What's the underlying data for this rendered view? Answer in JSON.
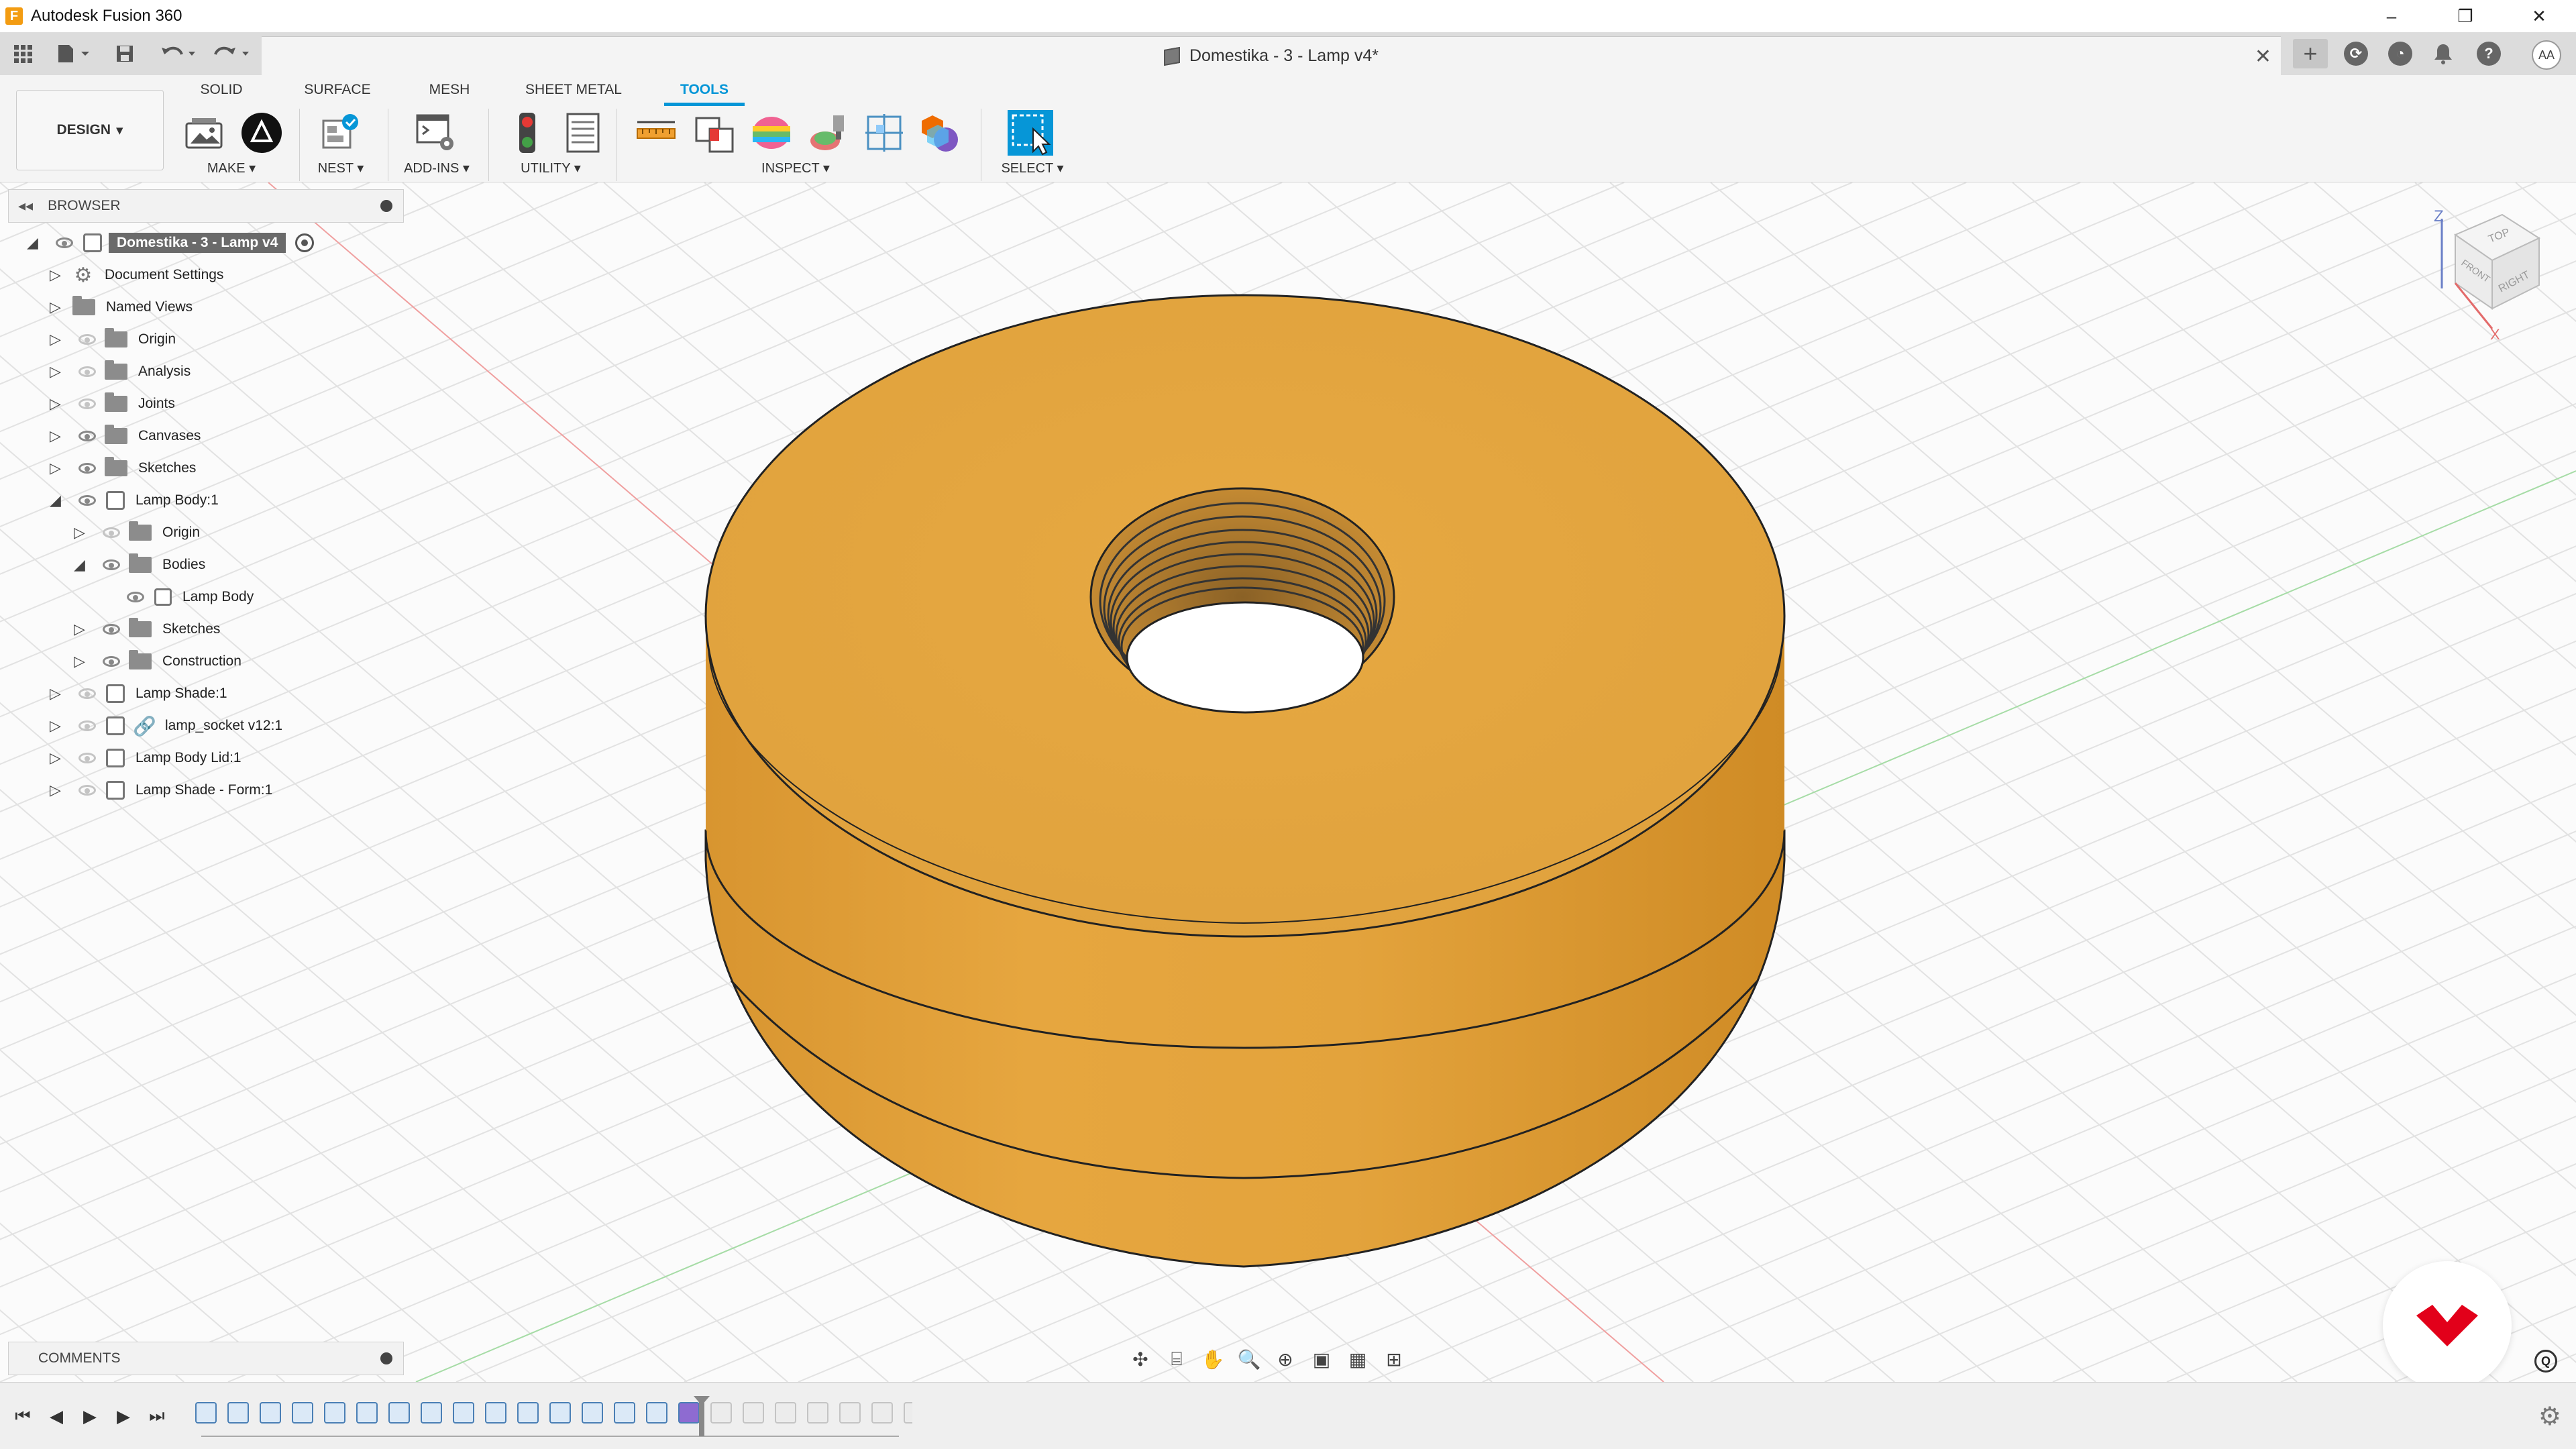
{
  "window": {
    "app_icon": "F",
    "title": "Autodesk Fusion 360",
    "controls": {
      "minimize": "–",
      "restore": "❐",
      "close": "✕"
    }
  },
  "tab": {
    "document_title": "Domestika - 3 - Lamp v4*",
    "close": "✕"
  },
  "right_icons": {
    "plus": "+",
    "avatar": "AA"
  },
  "workspace": {
    "label": "DESIGN",
    "chevron": "▾"
  },
  "toolbar": {
    "tabs": [
      {
        "label": "SOLID",
        "active": false
      },
      {
        "label": "SURFACE",
        "active": false
      },
      {
        "label": "MESH",
        "active": false
      },
      {
        "label": "SHEET METAL",
        "active": false
      },
      {
        "label": "TOOLS",
        "active": true
      }
    ],
    "groups": [
      {
        "label": "MAKE ▾"
      },
      {
        "label": "NEST ▾"
      },
      {
        "label": "ADD-INS ▾"
      },
      {
        "label": "UTILITY ▾"
      },
      {
        "label": "INSPECT ▾"
      },
      {
        "label": "SELECT ▾"
      }
    ]
  },
  "browser": {
    "collapse": "◂◂",
    "header": "BROWSER",
    "items": [
      {
        "label": "Domestika - 3 - Lamp v4",
        "expand": "◢",
        "kind": "root",
        "visible": true
      },
      {
        "label": "Document Settings",
        "expand": "▷",
        "kind": "gear",
        "visible": null
      },
      {
        "label": "Named Views",
        "expand": "▷",
        "kind": "folder",
        "visible": null
      },
      {
        "label": "Origin",
        "expand": "▷",
        "kind": "folder",
        "visible": false
      },
      {
        "label": "Analysis",
        "expand": "▷",
        "kind": "folder",
        "visible": false
      },
      {
        "label": "Joints",
        "expand": "▷",
        "kind": "folder",
        "visible": false
      },
      {
        "label": "Canvases",
        "expand": "▷",
        "kind": "folder",
        "visible": true
      },
      {
        "label": "Sketches",
        "expand": "▷",
        "kind": "folder",
        "visible": true
      },
      {
        "label": "Lamp Body:1",
        "expand": "◢",
        "kind": "component",
        "visible": true
      },
      {
        "label": "Origin",
        "expand": "▷",
        "kind": "folder",
        "visible": false
      },
      {
        "label": "Bodies",
        "expand": "◢",
        "kind": "folder",
        "visible": true
      },
      {
        "label": "Lamp Body",
        "expand": "",
        "kind": "body",
        "visible": true
      },
      {
        "label": "Sketches",
        "expand": "▷",
        "kind": "folder",
        "visible": true
      },
      {
        "label": "Construction",
        "expand": "▷",
        "kind": "folder",
        "visible": true
      },
      {
        "label": "Lamp Shade:1",
        "expand": "▷",
        "kind": "component",
        "visible": false
      },
      {
        "label": "lamp_socket v12:1",
        "expand": "▷",
        "kind": "link",
        "visible": false
      },
      {
        "label": "Lamp Body Lid:1",
        "expand": "▷",
        "kind": "component",
        "visible": false
      },
      {
        "label": "Lamp Shade - Form:1",
        "expand": "▷",
        "kind": "component",
        "visible": false
      }
    ]
  },
  "comments": {
    "header": "COMMENTS"
  },
  "viewcube": {
    "axis_z": "Z",
    "axis_x": "X",
    "top": "TOP",
    "right": "RIGHT",
    "front": "FRONT"
  },
  "timeline": {
    "controls": [
      "⏮",
      "◀",
      "▶",
      "▶",
      "⏭"
    ]
  },
  "colors": {
    "accent": "#0696d7",
    "model": "#e3a43e",
    "logo": "#e2001a"
  }
}
